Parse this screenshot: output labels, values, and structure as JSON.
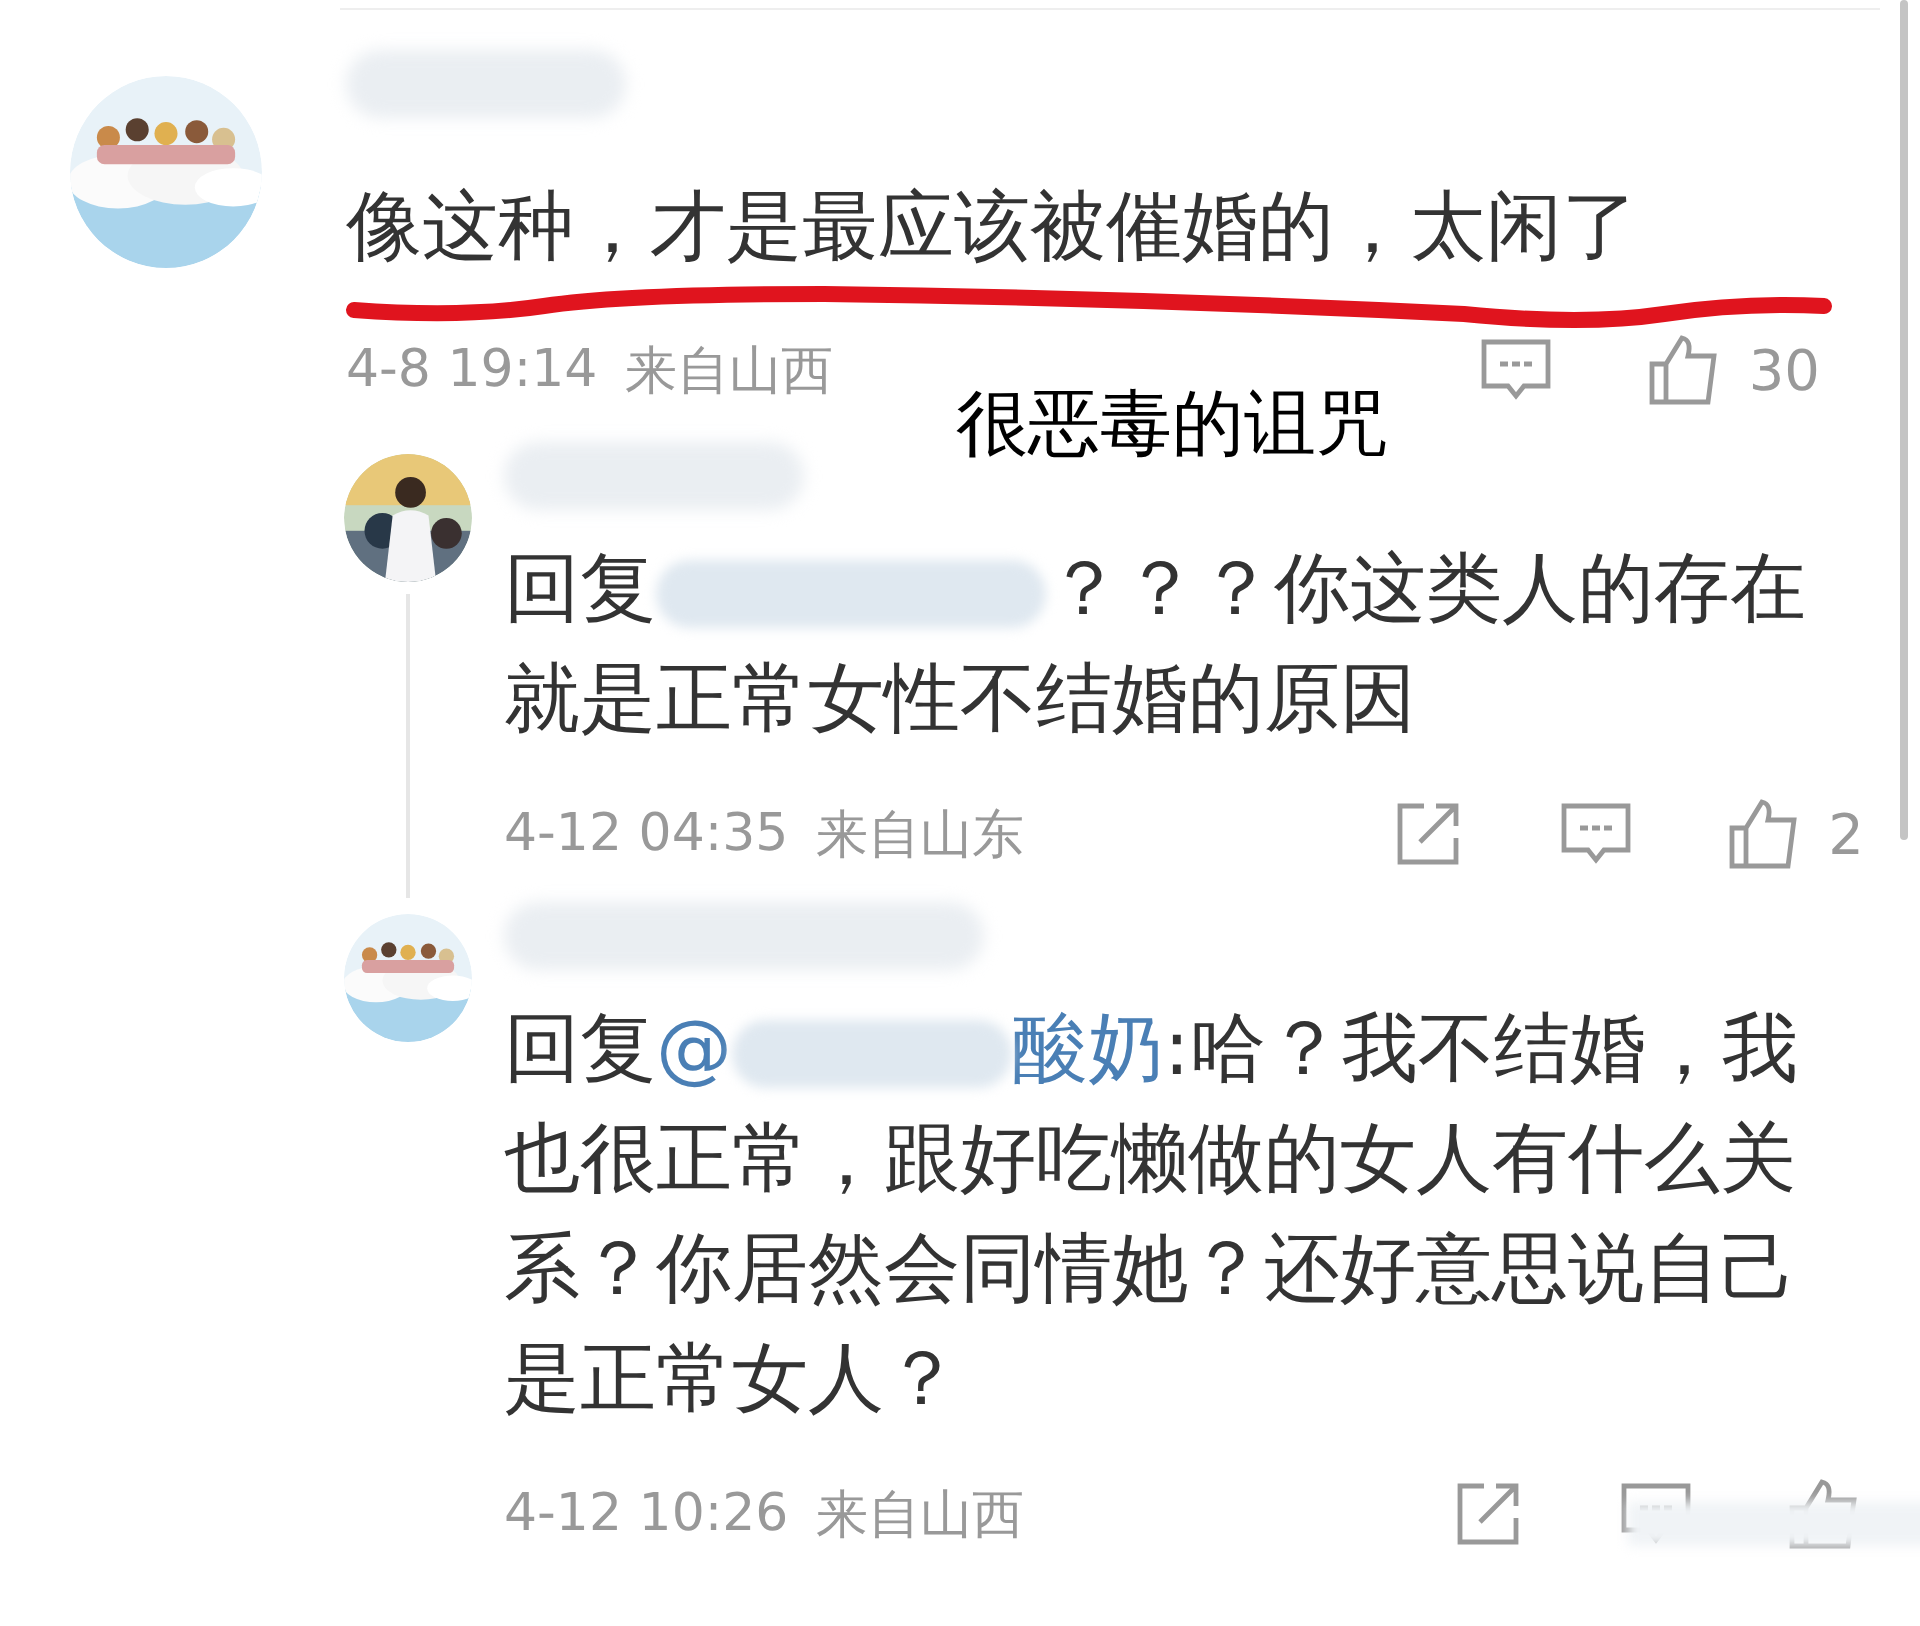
{
  "annotation": {
    "text": "很恶毒的诅咒"
  },
  "comment": {
    "name_blurred": true,
    "text": "像这种，才是最应该被催婚的，太闲了",
    "underlined": true,
    "time": "4-8 19:14",
    "location": "来自山西",
    "actions": [
      {
        "kind": "comment"
      },
      {
        "kind": "like",
        "count": "30"
      }
    ],
    "replies": [
      {
        "name_blurred": true,
        "prefix": "回复",
        "mention_blurred": true,
        "text": "？？？你这类人的存在就是正常女性不结婚的原因",
        "time": "4-12 04:35",
        "location": "来自山东",
        "actions": [
          {
            "kind": "share"
          },
          {
            "kind": "comment"
          },
          {
            "kind": "like",
            "count": "2"
          }
        ]
      },
      {
        "name_blurred": true,
        "prefix": "回复",
        "mention_start": "@",
        "mention_blurred": true,
        "mention_end": "酸奶",
        "text": ":哈？我不结婚，我也很正常，跟好吃懒做的女人有什么关系？你居然会同情她？还好意思说自己是正常女人？",
        "time": "4-12 10:26",
        "location": "来自山西",
        "actions": [
          {
            "kind": "share"
          },
          {
            "kind": "comment"
          },
          {
            "kind": "like"
          }
        ],
        "actions_blurred": true
      }
    ]
  }
}
